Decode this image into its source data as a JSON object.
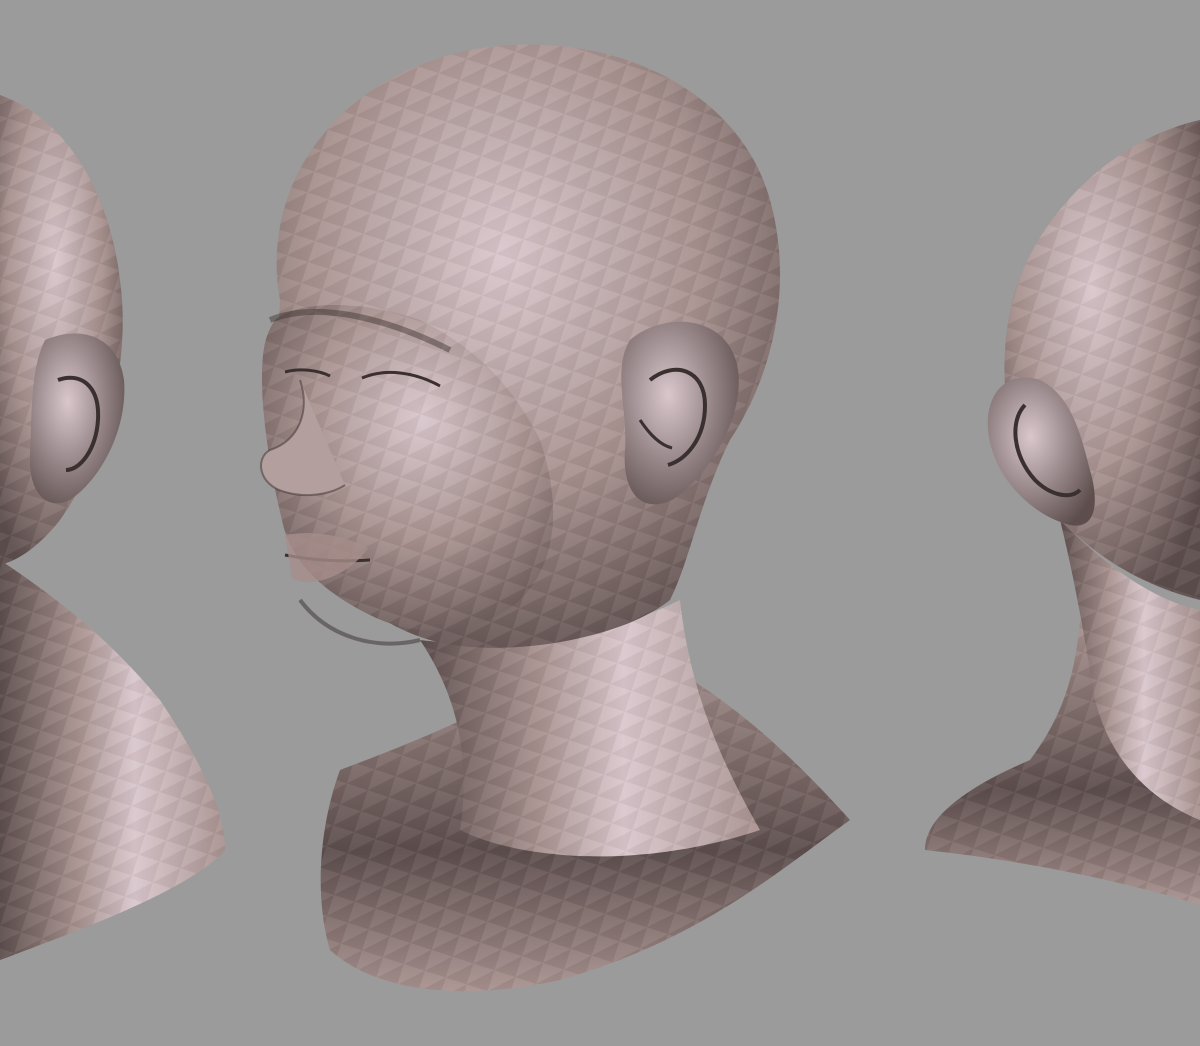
{
  "scene": {
    "background_color": "#9b9b9b",
    "clay_light": "#d9c7cd",
    "clay_mid": "#a8928f",
    "clay_dark": "#5d4e4d",
    "clay_shadow": "#3a302f"
  },
  "models": [
    {
      "id": "head-left",
      "view": "rear-three-quarter",
      "cropped": "left-edge"
    },
    {
      "id": "head-center",
      "view": "front-three-quarter",
      "cropped": "none"
    },
    {
      "id": "head-right",
      "view": "side-profile",
      "cropped": "right-edge"
    }
  ]
}
